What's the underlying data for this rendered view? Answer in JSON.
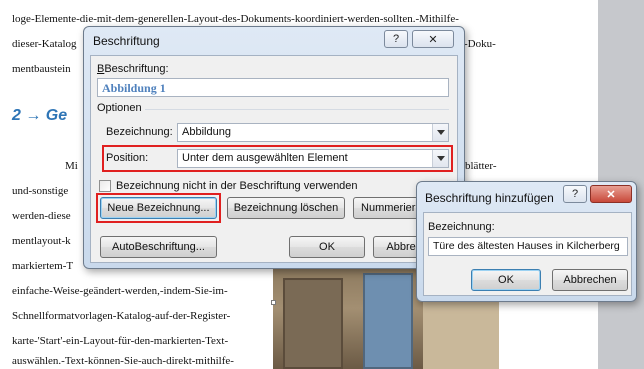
{
  "document": {
    "lines": [
      "loge-Elemente-die-mit-dem-generellen-Layout-des-Dokuments-koordiniert-werden-sollten.-Mithilfe-",
      "dieser-Katalog",
      "-Doku-",
      "mentbaustein",
      "Mi",
      "blätter-",
      "und-sonstige",
      "werden-diese",
      "mentlayout-k",
      "markiertem-T",
      "einfache-Weise-geändert-werden,-indem-Sie-im-",
      "Schnellformatvorlagen-Katalog-auf-der-Register-",
      "karte-'Start'-ein-Layout-für-den-markierten-Text-",
      "auswählen.-Text-können-Sie-auch-direkt-mithilfe-"
    ],
    "heading": "2 → Ge"
  },
  "caption_dialog": {
    "title": "Beschriftung",
    "help": "?",
    "close": "✕",
    "caption_label": "Beschriftung:",
    "caption_value": "Abbildung 1",
    "options_label": "Optionen",
    "label_label": "Bezeichnung:",
    "label_value": "Abbildung",
    "position_label": "Position:",
    "position_value": "Unter dem ausgewählten Element",
    "exclude_label": "Bezeichnung nicht in der Beschriftung verwenden",
    "new_label_btn": "Neue Bezeichnung...",
    "delete_label_btn": "Bezeichnung löschen",
    "numbering_btn": "Nummerierung...",
    "autocaption_btn": "AutoBeschriftung...",
    "ok_btn": "OK",
    "cancel_btn": "Abbrechen"
  },
  "add_dialog": {
    "title": "Beschriftung hinzufügen",
    "help": "?",
    "close": "✕",
    "label_label": "Bezeichnung:",
    "label_value": "Türe des ältesten Hauses in Kilcherberg",
    "ok_btn": "OK",
    "cancel_btn": "Abbrechen"
  },
  "colors": {
    "highlight": "#e02020",
    "caption_text": "#4f81bd",
    "heading": "#2e75b6"
  }
}
